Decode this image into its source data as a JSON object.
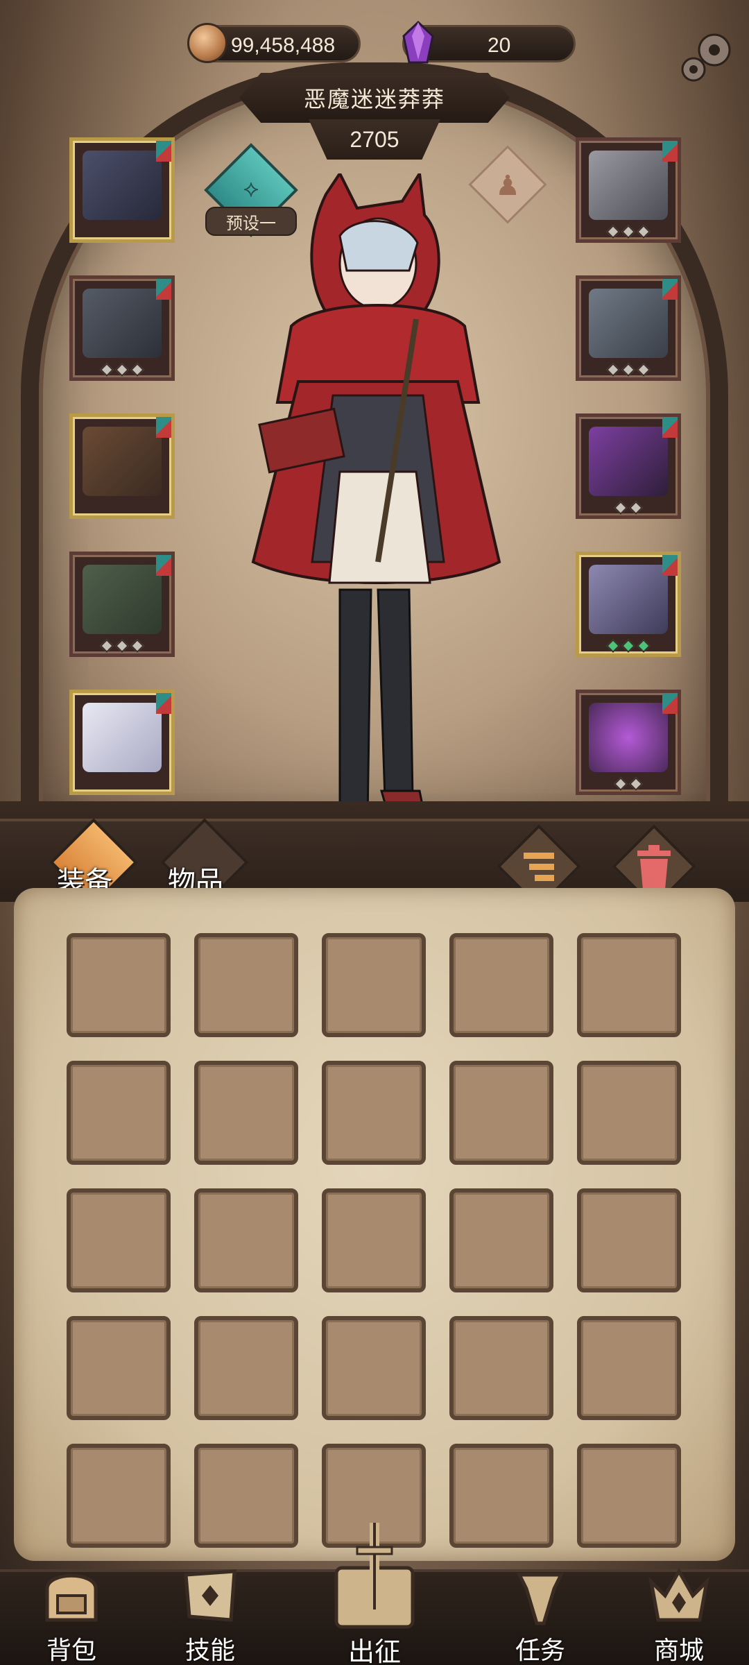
{
  "currency": {
    "gold": "99,458,488",
    "gems": "20"
  },
  "character": {
    "name": "恶魔迷迷莽莽",
    "power": "2705"
  },
  "preset": {
    "label": "预设一"
  },
  "equipment_slots": {
    "left": [
      {
        "item": "dark-amulet",
        "frame": "gold",
        "stars": 0
      },
      {
        "item": "spiked-armor",
        "frame": "red",
        "stars": 3
      },
      {
        "item": "leather-gauntlet",
        "frame": "gold",
        "stars": 0
      },
      {
        "item": "tattered-pants",
        "frame": "red",
        "stars": 3
      },
      {
        "item": "winged-boots",
        "frame": "gold",
        "stars": 0
      }
    ],
    "right": [
      {
        "item": "horned-helmet",
        "frame": "red",
        "stars": 3
      },
      {
        "item": "chain-ring",
        "frame": "red",
        "stars": 3
      },
      {
        "item": "purple-bracer",
        "frame": "red",
        "stars": 2
      },
      {
        "item": "crystal-staff",
        "frame": "gold",
        "stars": 3,
        "star_color": "green"
      },
      {
        "item": "orb-relic",
        "frame": "red",
        "stars": 2
      }
    ]
  },
  "tabs": {
    "equipment": "装备",
    "items": "物品"
  },
  "inventory": {
    "rows": 5,
    "cols": 5
  },
  "nav": {
    "bag": "背包",
    "skills": "技能",
    "expedition": "出征",
    "quests": "任务",
    "shop": "商城"
  },
  "colors": {
    "accent_gold": "#e7a453",
    "teal": "#4fb5ad",
    "frame_dark": "#3a2b22"
  }
}
